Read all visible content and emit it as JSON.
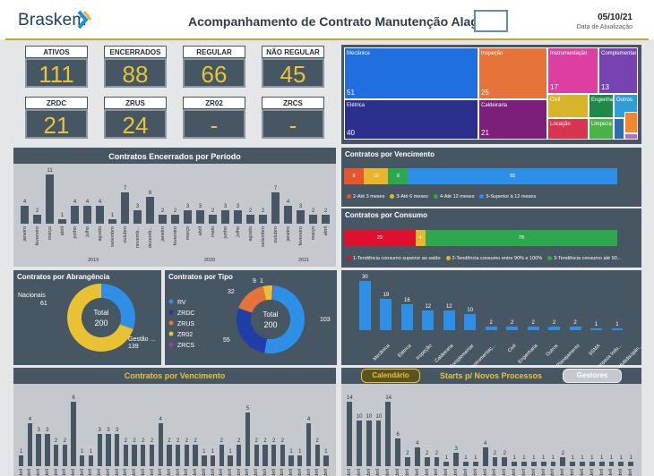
{
  "header": {
    "logo": "Braskem",
    "title": "Acompanhamento de Contrato Manutenção Alagoas",
    "date": "05/10/21",
    "date_label": "Data de Atualização"
  },
  "kpis": [
    {
      "label": "ATIVOS",
      "value": "111"
    },
    {
      "label": "ENCERRADOS",
      "value": "88"
    },
    {
      "label": "REGULAR",
      "value": "66"
    },
    {
      "label": "NÃO REGULAR",
      "value": "45"
    },
    {
      "label": "ZRDC",
      "value": "21"
    },
    {
      "label": "ZRUS",
      "value": "24"
    },
    {
      "label": "ZR02",
      "value": "-"
    },
    {
      "label": "ZRCS",
      "value": "-"
    }
  ],
  "treemap": [
    {
      "name": "Mecânica",
      "value": "51",
      "color": "#1f6fe0"
    },
    {
      "name": "Inspeção",
      "value": "25",
      "color": "#e5733a"
    },
    {
      "name": "Instrumentação",
      "value": "17",
      "color": "#dd3fa1"
    },
    {
      "name": "Complementar",
      "value": "13",
      "color": "#7743b2"
    },
    {
      "name": "Elétrica",
      "value": "40",
      "color": "#2c2f8e"
    },
    {
      "name": "Caldeiraria",
      "value": "21",
      "color": "#7c1f7a"
    },
    {
      "name": "Civil",
      "value": "",
      "color": "#d6b52a"
    },
    {
      "name": "Engenharia",
      "value": "",
      "color": "#1e8a4a"
    },
    {
      "name": "Outros",
      "value": "",
      "color": "#2f9ed8"
    },
    {
      "name": "Locação",
      "value": "",
      "color": "#d8344f"
    },
    {
      "name": "Limpeza",
      "value": "",
      "color": "#49b347"
    },
    {
      "name": "",
      "value": "",
      "color": "#f08630"
    },
    {
      "name": "",
      "value": "",
      "color": "#2e6bb0"
    },
    {
      "name": "",
      "value": "",
      "color": "#b26fcf"
    }
  ],
  "encerrados": {
    "title": "Contratos Encerrados por Período",
    "chart_data": {
      "type": "bar",
      "categories": [
        "janeiro",
        "fevereiro",
        "março",
        "abril",
        "junho",
        "julho",
        "agosto",
        "setembro",
        "outubro",
        "novemb...",
        "dezemb...",
        "janeiro",
        "fevereiro",
        "março",
        "abril",
        "maio",
        "junho",
        "julho",
        "agosto",
        "setembro",
        "outubro",
        "janeiro",
        "fevereiro",
        "março",
        "abril",
        "maio"
      ],
      "values": [
        4,
        2,
        11,
        1,
        4,
        4,
        4,
        1,
        7,
        3,
        6,
        2,
        2,
        3,
        3,
        2,
        3,
        3,
        2,
        2,
        7,
        4,
        3,
        2,
        2
      ],
      "years": [
        "2019",
        "2020",
        "2021"
      ]
    }
  },
  "vencimento_bar": {
    "title": "Contratos por Vencimento",
    "chart_data": {
      "type": "bar",
      "segments": [
        {
          "name": "2-Até 3 meses",
          "value": 8,
          "color": "#e4572e"
        },
        {
          "name": "3-Até 6 meses",
          "value": 10,
          "color": "#e8b52b"
        },
        {
          "name": "4-Até 12 meses",
          "value": 8,
          "color": "#2ea84f"
        },
        {
          "name": "5-Superior à 12 meses",
          "value": 85,
          "color": "#2d8fe6"
        }
      ]
    }
  },
  "consumo_bar": {
    "title": "Contratos por Consumo",
    "chart_data": {
      "type": "bar",
      "segments": [
        {
          "name": "1-Tendência consumo superior ao saldo",
          "value": 29,
          "color": "#e0102d"
        },
        {
          "name": "2-Tendência consumo entre 90% e 100%",
          "value": 4,
          "color": "#e8b52b"
        },
        {
          "name": "3-Tendência consumo até 90...",
          "value": 78,
          "color": "#2ea84f"
        }
      ]
    }
  },
  "abrangencia": {
    "title": "Contratos por Abrangência",
    "total_label": "Total",
    "total": "200",
    "chart_data": {
      "type": "pie",
      "slices": [
        {
          "name": "Nacionais",
          "value": 61,
          "color": "#2d8fe6"
        },
        {
          "name": "Gestão ...",
          "value": 139,
          "color": "#e8c232"
        }
      ]
    }
  },
  "tipo": {
    "title": "Contratos por Tipo",
    "total_label": "Total",
    "total": "200",
    "chart_data": {
      "type": "pie",
      "slices": [
        {
          "name": "RV",
          "value": 103,
          "color": "#2d8fe6"
        },
        {
          "name": "ZRDC",
          "value": 55,
          "color": "#1f3ea8"
        },
        {
          "name": "ZRUS",
          "value": 32,
          "color": "#e5733a"
        },
        {
          "name": "ZR02",
          "value": 9,
          "color": "#e8c232"
        },
        {
          "name": "ZRCS",
          "value": 1,
          "color": "#9a3fa8"
        }
      ]
    },
    "legend": [
      "RV",
      "ZRDC",
      "ZRUS",
      "ZR02",
      "ZRCS"
    ]
  },
  "especialidade": {
    "chart_data": {
      "type": "bar",
      "categories": [
        "Mecânica",
        "Elétrica",
        "Inspeção",
        "Caldeiraria",
        "Complementar",
        "Instrumentaç...",
        "Civil",
        "Engenharia",
        "Outros",
        "Planejamento",
        "SSMA",
        "Limpeza Indu...",
        "Multidisciplin..."
      ],
      "values": [
        30,
        19,
        16,
        12,
        12,
        10,
        2,
        2,
        2,
        2,
        2,
        1,
        1
      ]
    }
  },
  "vencimento_mensal": {
    "title": "Contratos por Vencimento",
    "chart_data": {
      "type": "bar",
      "values": [
        1,
        4,
        3,
        3,
        2,
        2,
        6,
        1,
        1,
        3,
        3,
        3,
        2,
        2,
        2,
        2,
        4,
        2,
        2,
        2,
        2,
        1,
        1,
        2,
        1,
        2,
        5,
        2,
        2,
        2,
        2,
        1,
        1,
        4,
        2,
        1
      ]
    }
  },
  "starts": {
    "tab_calendario": "Calendário",
    "title": "Starts p/ Novos Processos",
    "tab_gestores": "Gestores",
    "chart_data": {
      "type": "bar",
      "values": [
        14,
        10,
        10,
        10,
        14,
        6,
        2,
        4,
        2,
        2,
        1,
        3,
        1,
        1,
        4,
        2,
        2,
        1,
        1,
        1,
        1,
        1,
        2,
        1,
        1,
        1,
        1,
        1,
        1,
        1
      ]
    }
  },
  "xlabel_month": "abril"
}
